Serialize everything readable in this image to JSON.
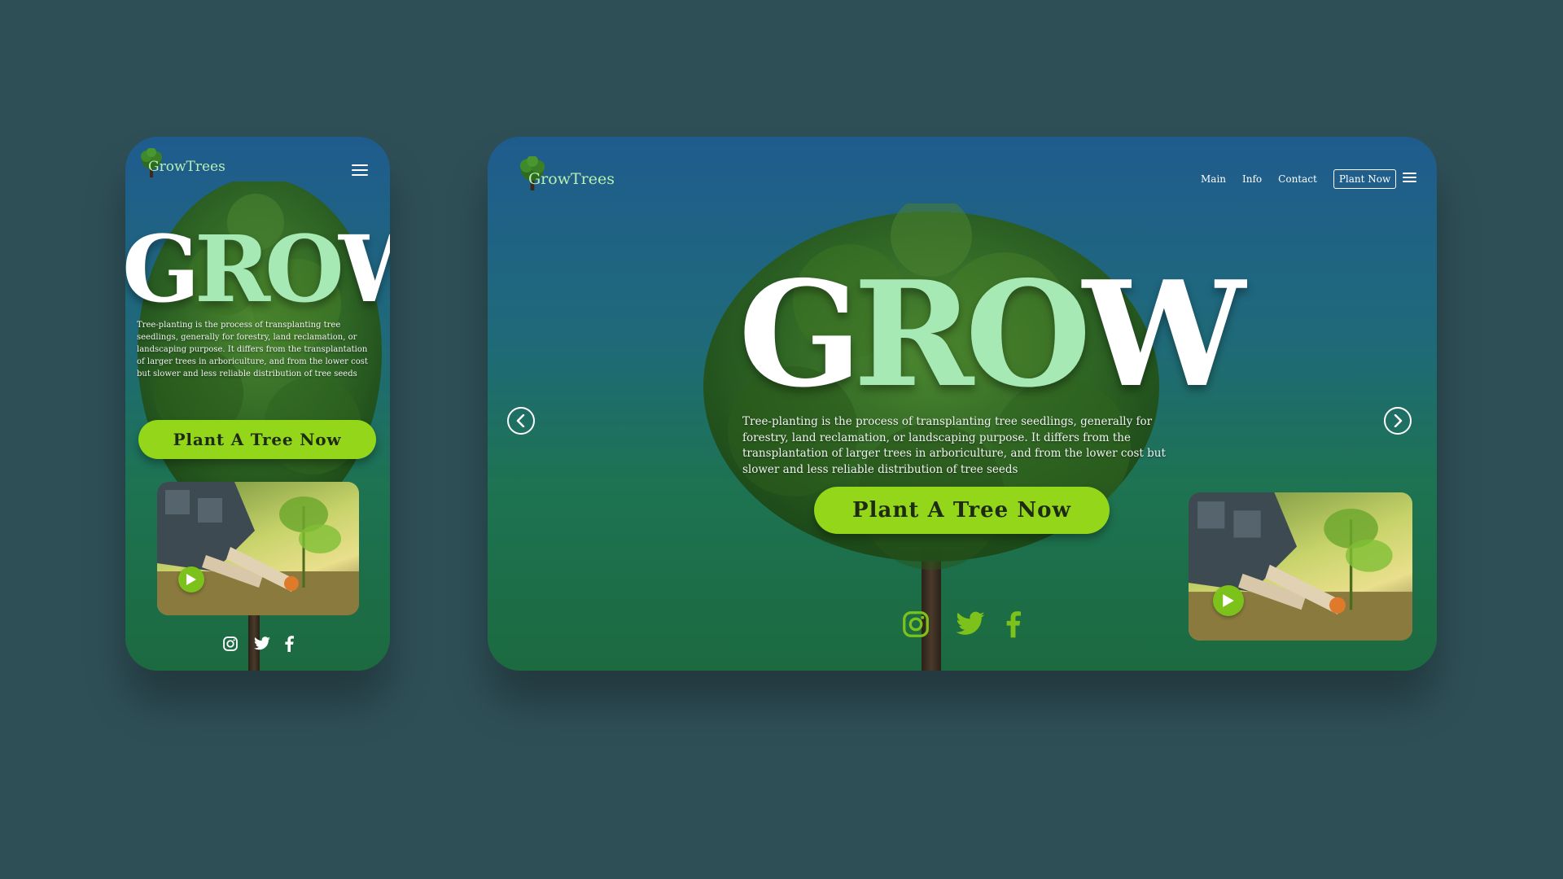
{
  "brand": {
    "logo_text": "GrowTrees"
  },
  "hero": {
    "headline": {
      "g": "G",
      "ro": "RO",
      "w": "W"
    },
    "description": "Tree-planting is the process of transplanting tree seedlings, generally for forestry, land reclamation, or landscaping purpose. It differs from the transplantation of larger trees in arboriculture, and from the lower cost but slower and less reliable distribution of tree seeds",
    "cta_label": "Plant A Tree Now"
  },
  "nav": {
    "items": [
      "Main",
      "Info",
      "Contact"
    ],
    "plant_now": "Plant Now"
  },
  "video": {
    "thumbnail": "person-planting-sapling"
  },
  "socials": [
    "instagram-icon",
    "twitter-icon",
    "facebook-icon"
  ],
  "colors": {
    "background": "#2f4f57",
    "card_top": "#1f5c8e",
    "card_bottom": "#1c6a40",
    "accent_green": "#93d61a",
    "logo_text": "#b7f0b2",
    "grow_mid_letters": "#a6e9b4"
  }
}
